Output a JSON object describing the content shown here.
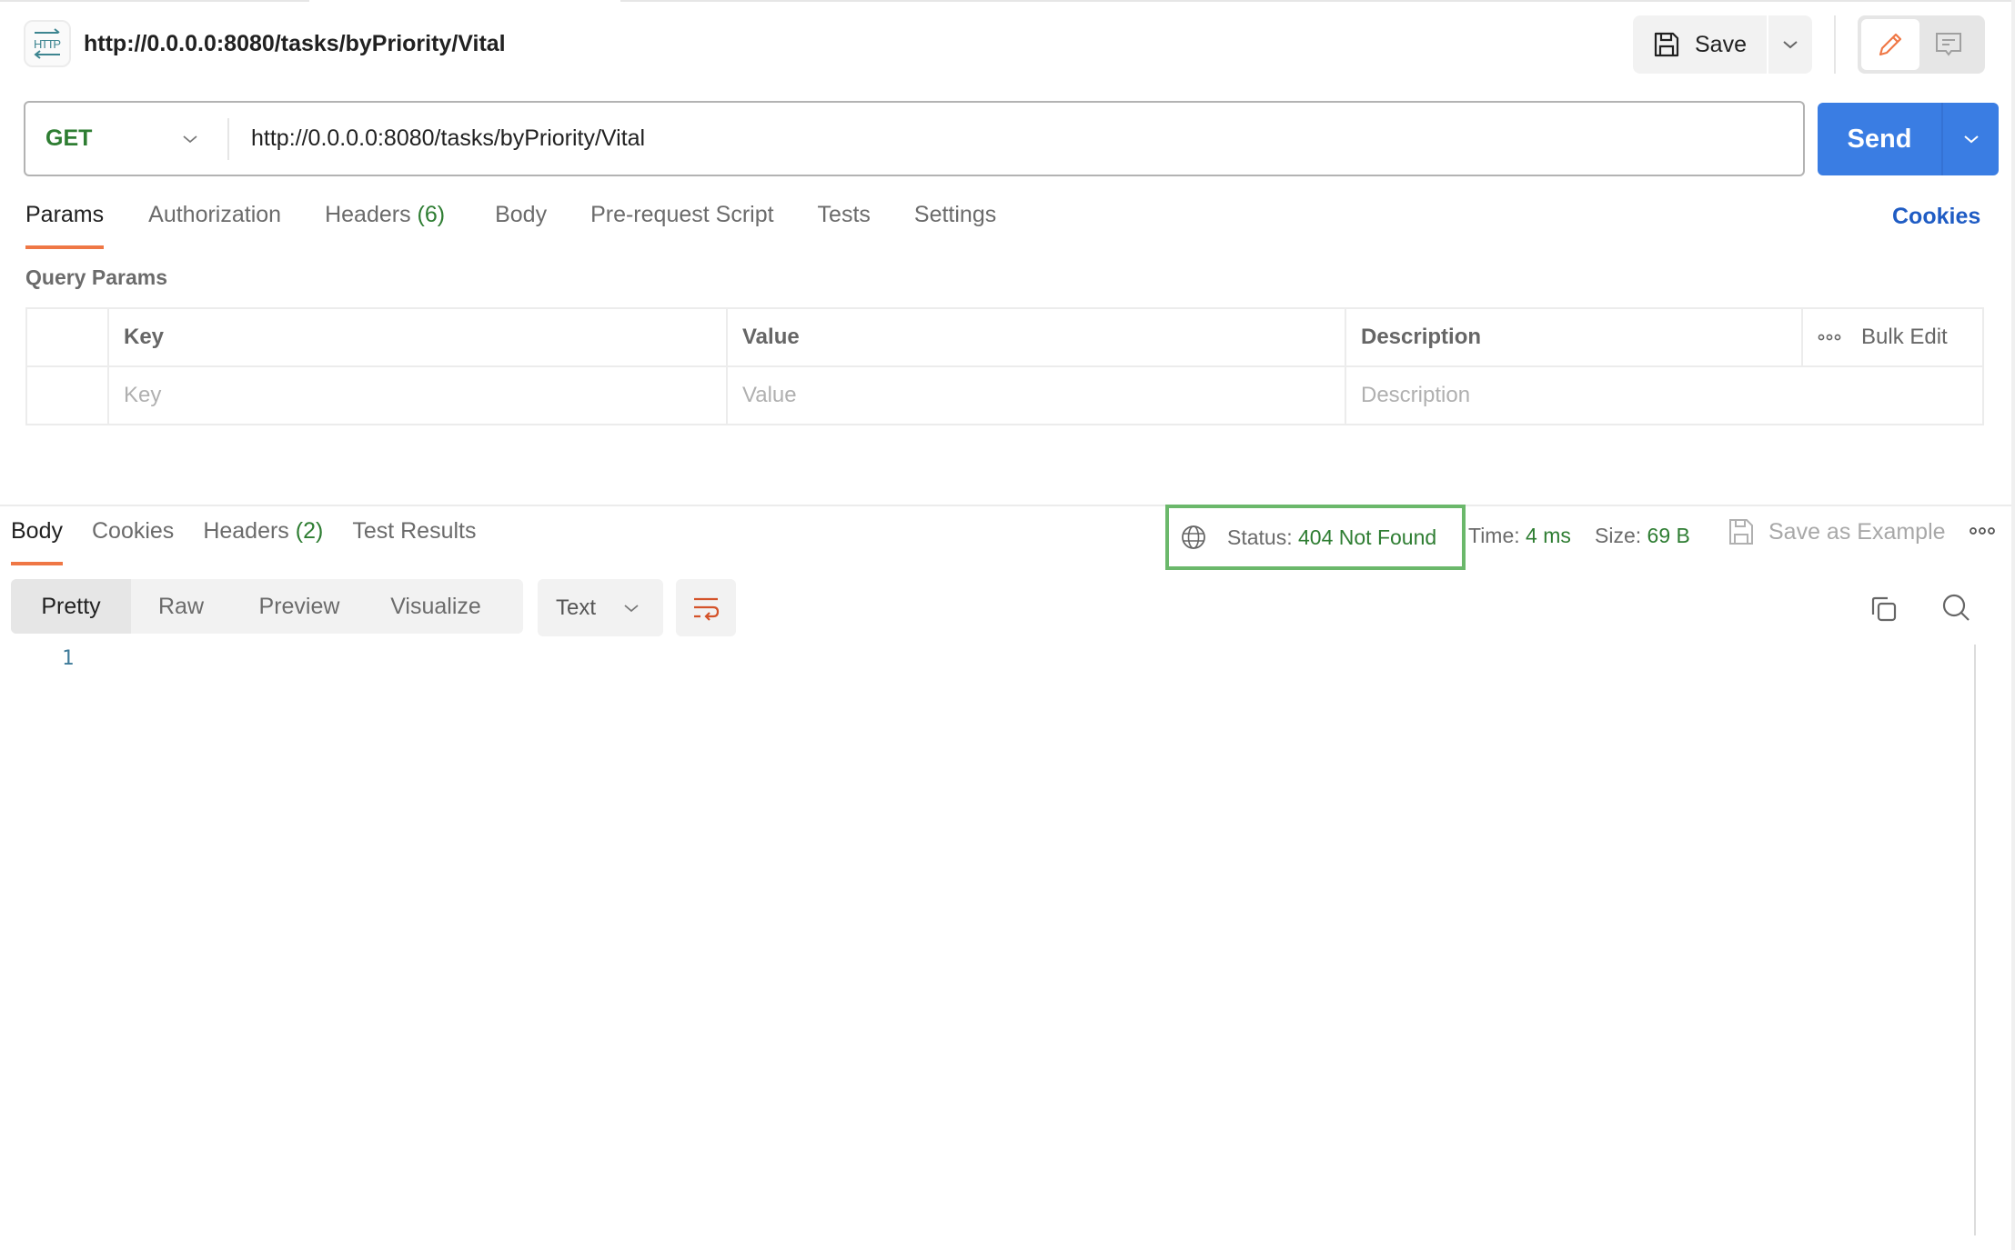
{
  "header": {
    "icon": "http-icon",
    "title": "http://0.0.0.0:8080/tasks/byPriority/Vital",
    "save_label": "Save",
    "save_icon": "save-icon",
    "modes": [
      {
        "name": "edit",
        "icon": "pencil-icon",
        "active": true
      },
      {
        "name": "comments",
        "icon": "comment-icon",
        "active": false
      }
    ]
  },
  "request": {
    "method": "GET",
    "url": "http://0.0.0.0:8080/tasks/byPriority/Vital",
    "send_label": "Send",
    "tabs": [
      {
        "label": "Params",
        "active": true
      },
      {
        "label": "Authorization"
      },
      {
        "label": "Headers",
        "count": "(6)"
      },
      {
        "label": "Body"
      },
      {
        "label": "Pre-request Script"
      },
      {
        "label": "Tests"
      },
      {
        "label": "Settings"
      }
    ],
    "cookies_link": "Cookies",
    "query_params_label": "Query Params",
    "table": {
      "headers": [
        "Key",
        "Value",
        "Description"
      ],
      "bulk_edit": "Bulk Edit",
      "placeholders": {
        "key": "Key",
        "value": "Value",
        "description": "Description"
      }
    }
  },
  "response": {
    "tabs": [
      {
        "label": "Body",
        "active": true
      },
      {
        "label": "Cookies"
      },
      {
        "label": "Headers",
        "count": "(2)"
      },
      {
        "label": "Test Results"
      }
    ],
    "status_label": "Status:",
    "status_value": "404 Not Found",
    "time_label": "Time:",
    "time_value": "4 ms",
    "size_label": "Size:",
    "size_value": "69 B",
    "save_example": "Save as Example",
    "formats": [
      "Pretty",
      "Raw",
      "Preview",
      "Visualize"
    ],
    "active_format": "Pretty",
    "language": "Text",
    "line_numbers": [
      "1"
    ]
  },
  "colors": {
    "accent": "#ef7745",
    "send": "#3a7de3",
    "success_green": "#2e7d32",
    "link_blue": "#1f5cc4",
    "highlight_box": "#6bb86b"
  }
}
